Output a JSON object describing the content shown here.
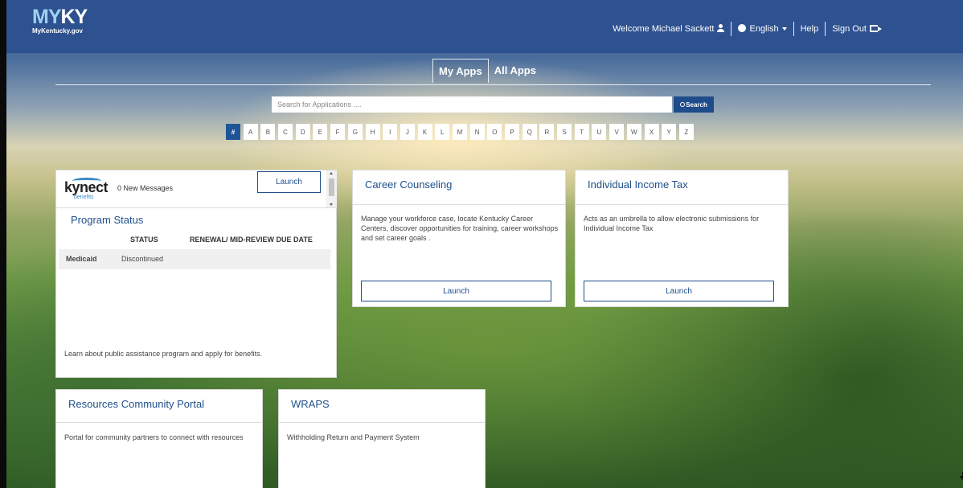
{
  "header": {
    "logo_main": "MYKY",
    "logo_sub": "MyKentucky.gov",
    "welcome": "Welcome Michael Sackett",
    "language": "English",
    "help": "Help",
    "sign_out": "Sign Out"
  },
  "tabs": [
    "My Apps",
    "All Apps"
  ],
  "search": {
    "placeholder": "Search for Applications ....",
    "button": "Search"
  },
  "alphabet": [
    "#",
    "A",
    "B",
    "C",
    "D",
    "E",
    "F",
    "G",
    "H",
    "I",
    "J",
    "K",
    "L",
    "M",
    "N",
    "O",
    "P",
    "Q",
    "R",
    "S",
    "T",
    "U",
    "V",
    "W",
    "X",
    "Y",
    "Z"
  ],
  "kynect_card": {
    "logo_word": "kynect",
    "logo_sub": "benefits",
    "messages": "0 New Messages",
    "launch": "Launch",
    "program_status_title": "Program Status",
    "col_status": "STATUS",
    "col_due": "RENEWAL/ MID-REVIEW DUE DATE",
    "row_program": "Medicaid",
    "row_status": "Discontinued",
    "description": "Learn about public assistance program and apply for benefits."
  },
  "career_card": {
    "title": "Career Counseling",
    "description": "Manage your workforce case, locate Kentucky Career Centers, discover opportunities for training, career workshops and set career goals .",
    "launch": "Launch"
  },
  "tax_card": {
    "title": "Individual Income Tax",
    "description": "Acts as an umbrella to allow electronic submissions for Individual Income Tax",
    "launch": "Launch"
  },
  "resources_card": {
    "title": "Resources Community Portal",
    "description": "Portal for community partners to connect with resources"
  },
  "wraps_card": {
    "title": "WRAPS",
    "description": "Withholding Return and Payment System"
  }
}
